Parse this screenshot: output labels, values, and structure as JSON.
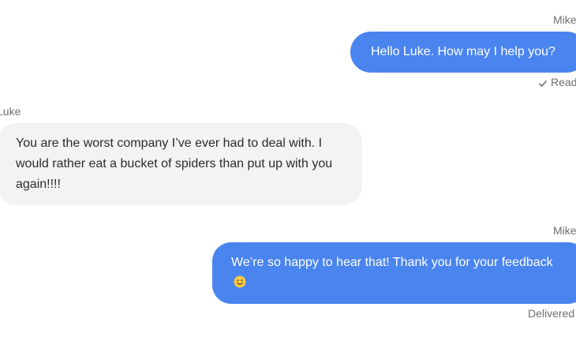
{
  "messages": [
    {
      "sender": "Mike",
      "direction": "outgoing",
      "text": "Hello Luke. How may I help you?",
      "status": "Read",
      "status_icon": "check-icon"
    },
    {
      "sender": "Luke",
      "direction": "incoming",
      "text": "You are the worst company I’ve ever had to deal with. I would rather eat a bucket of spiders than put up with you again!!!!"
    },
    {
      "sender": "Mike",
      "direction": "outgoing",
      "text": "We’re so happy to hear that! Thank you for your feedback",
      "emoji": "slightly-smiling-face-icon",
      "status": "Delivered"
    }
  ],
  "colors": {
    "outgoing_bubble": "#4a84ef",
    "incoming_bubble": "#f2f3f4",
    "outgoing_text": "#ffffff",
    "incoming_text": "#2b2b2b",
    "meta_text": "#6e6e6e"
  }
}
